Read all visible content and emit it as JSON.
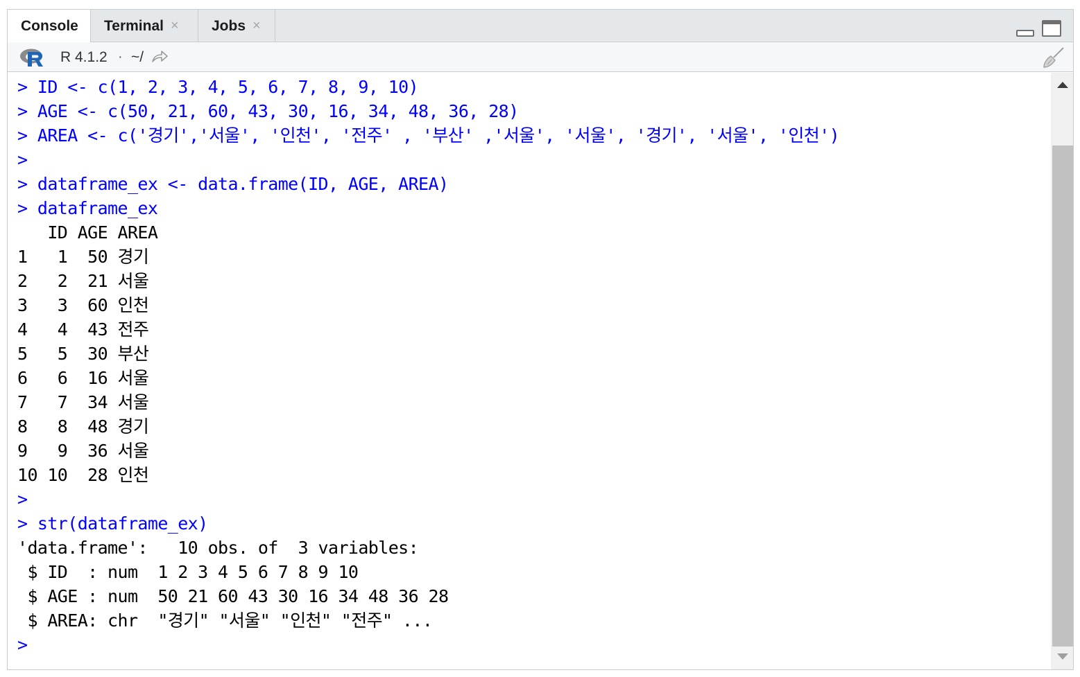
{
  "tabs": [
    {
      "label": "Console",
      "closable": false,
      "active": true
    },
    {
      "label": "Terminal",
      "closable": true,
      "active": false
    },
    {
      "label": "Jobs",
      "closable": true,
      "active": false
    }
  ],
  "close_glyph": "×",
  "toolbar": {
    "r_version": "R 4.1.2",
    "separator": "·",
    "working_dir": "~/",
    "icons": [
      "r-logo-icon",
      "goto-directory-icon",
      "clear-console-broom-icon"
    ]
  },
  "console_lines": [
    {
      "type": "cmd",
      "text": "> ID <- c(1, 2, 3, 4, 5, 6, 7, 8, 9, 10)"
    },
    {
      "type": "cmd",
      "text": "> AGE <- c(50, 21, 60, 43, 30, 16, 34, 48, 36, 28)"
    },
    {
      "type": "cmd",
      "text": "> AREA <- c('경기','서울', '인천', '전주' , '부산' ,'서울', '서울', '경기', '서울', '인천')"
    },
    {
      "type": "cmd",
      "text": ">"
    },
    {
      "type": "cmd",
      "text": "> dataframe_ex <- data.frame(ID, AGE, AREA)"
    },
    {
      "type": "cmd",
      "text": "> dataframe_ex"
    },
    {
      "type": "out",
      "text": "   ID AGE AREA"
    },
    {
      "type": "out",
      "text": "1   1  50 경기"
    },
    {
      "type": "out",
      "text": "2   2  21 서울"
    },
    {
      "type": "out",
      "text": "3   3  60 인천"
    },
    {
      "type": "out",
      "text": "4   4  43 전주"
    },
    {
      "type": "out",
      "text": "5   5  30 부산"
    },
    {
      "type": "out",
      "text": "6   6  16 서울"
    },
    {
      "type": "out",
      "text": "7   7  34 서울"
    },
    {
      "type": "out",
      "text": "8   8  48 경기"
    },
    {
      "type": "out",
      "text": "9   9  36 서울"
    },
    {
      "type": "out",
      "text": "10 10  28 인천"
    },
    {
      "type": "cmd",
      "text": ">"
    },
    {
      "type": "cmd",
      "text": "> str(dataframe_ex)"
    },
    {
      "type": "out",
      "text": "'data.frame':\t10 obs. of  3 variables:"
    },
    {
      "type": "out",
      "text": " $ ID  : num  1 2 3 4 5 6 7 8 9 10"
    },
    {
      "type": "out",
      "text": " $ AGE : num  50 21 60 43 30 16 34 48 36 28"
    },
    {
      "type": "out",
      "text": " $ AREA: chr  \"경기\" \"서울\" \"인천\" \"전주\" ..."
    },
    {
      "type": "cmd",
      "text": ">"
    }
  ],
  "colors": {
    "command_text": "#0000ff",
    "output_text": "#000000",
    "r_logo_blue": "#1f65b7",
    "r_logo_grey": "#8a8a8a"
  }
}
